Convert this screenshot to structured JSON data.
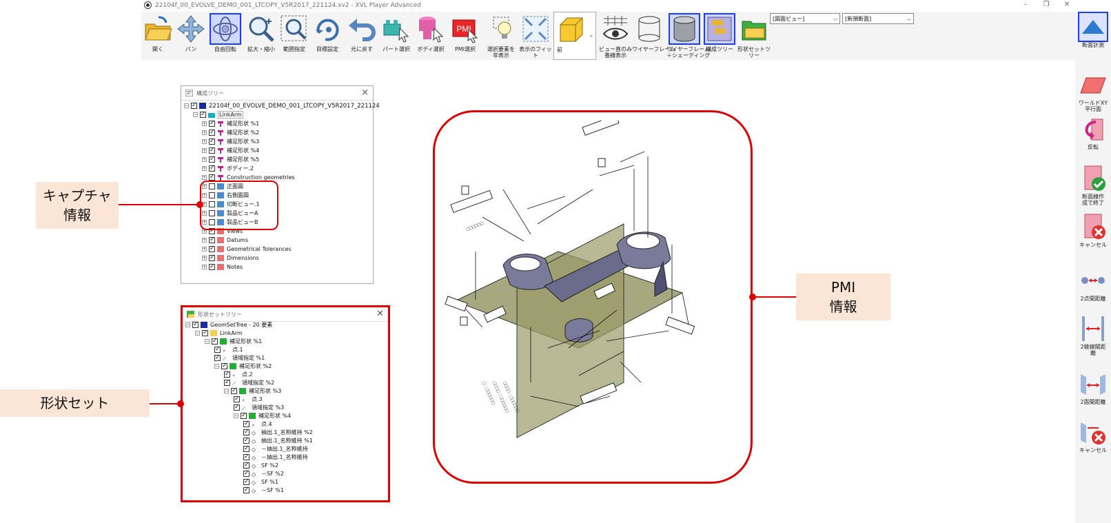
{
  "window": {
    "title": "22104f_00_EVOLVE_DEMO_001_LTCOPY_V5R2017_221124.xv2 - XVL Player Advanced"
  },
  "toolbar": {
    "buttons": [
      {
        "label": "開く"
      },
      {
        "label": "パン"
      },
      {
        "label": "自由回転"
      },
      {
        "label": "拡大・縮小"
      },
      {
        "label": "範囲指定"
      },
      {
        "label": "目標設定"
      },
      {
        "label": "元に戻す"
      },
      {
        "label": "パート選択"
      },
      {
        "label": "ボディ選択"
      },
      {
        "label": "PMI選択"
      },
      {
        "label": "選択要素を\n非表示"
      },
      {
        "label": "表示のフィッ\nト"
      },
      {
        "label": "前"
      },
      {
        "label": "ビュー直のみ\n番線表示"
      },
      {
        "label": "ワイヤーフレーム"
      },
      {
        "label": "ワイヤーフレーム\n＋シェーディング"
      },
      {
        "label": "構成ツリー"
      },
      {
        "label": "形状セットツ\nリー"
      }
    ],
    "drawing_view_select": "[図面ビュー]",
    "section_select": "[新規断面]",
    "section_measure_label": "断面計測"
  },
  "right_panel": {
    "buttons": [
      {
        "label": "ワールドXY\n平行面"
      },
      {
        "label": "反転"
      },
      {
        "label": "断面線作\n成で終了"
      },
      {
        "label": "キャンセル"
      },
      {
        "label": "2点間距離"
      },
      {
        "label": "2稜線間距\n離"
      },
      {
        "label": "2面間距離"
      },
      {
        "label": "キャンセル"
      }
    ]
  },
  "structure_tree": {
    "title": "構成ツリー",
    "rows": [
      {
        "text": "22104f_00_EVOLVE_DEMO_001_LTCOPY_V5R2017_221124"
      },
      {
        "text": "LinkArm"
      },
      {
        "text": "補足形状 %1"
      },
      {
        "text": "補足形状 %2"
      },
      {
        "text": "補足形状 %3"
      },
      {
        "text": "補足形状 %4"
      },
      {
        "text": "補足形状 %5"
      },
      {
        "text": "ボディー.2"
      },
      {
        "text": "Construction geometries"
      },
      {
        "text": "正面図"
      },
      {
        "text": "右側面図"
      },
      {
        "text": "切断ビュー.1"
      },
      {
        "text": "製品ビューA"
      },
      {
        "text": "製品ビューB"
      },
      {
        "text": "Views"
      },
      {
        "text": "Datums"
      },
      {
        "text": "Geometrical Tolerances"
      },
      {
        "text": "Dimensions"
      },
      {
        "text": "Notes"
      }
    ]
  },
  "geomset_tree": {
    "title": "形状セットツリー",
    "rows": [
      {
        "text": "GeomSetTree - 20 要素"
      },
      {
        "text": "LinkArm"
      },
      {
        "text": "補足形状 %1"
      },
      {
        "text": "点.1"
      },
      {
        "text": "領域指定 %1"
      },
      {
        "text": "補足形状 %2"
      },
      {
        "text": "点.2"
      },
      {
        "text": "領域指定 %2"
      },
      {
        "text": "補足形状 %3"
      },
      {
        "text": "点.3"
      },
      {
        "text": "領域指定 %3"
      },
      {
        "text": "補足形状 %4"
      },
      {
        "text": "点.4"
      },
      {
        "text": "抽出.1_名称維持 %2"
      },
      {
        "text": "抽出.1_名称維持 %1"
      },
      {
        "text": "－抽出.1_名称維持"
      },
      {
        "text": "－抽出.1_名称維持"
      },
      {
        "text": "SF %2"
      },
      {
        "text": "－SF %2"
      },
      {
        "text": "SF %1"
      },
      {
        "text": "－SF %1"
      }
    ]
  },
  "callouts": {
    "capture": "キャプチャ\n情報",
    "pmi": "PMI\n情報",
    "geomset": "形状セット"
  },
  "colors": {
    "highlight_red": "#e00000",
    "callout_bg": "#fbe5d6",
    "selected_blue": "#1a3cff"
  }
}
